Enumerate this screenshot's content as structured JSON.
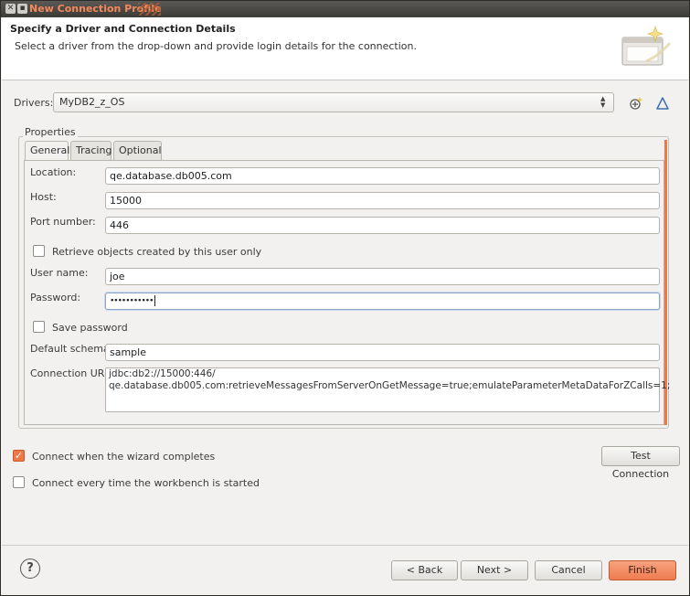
{
  "window": {
    "title": "New Connection Profile",
    "header_title": "Specify a Driver and Connection Details",
    "header_description": "Select a driver from the drop-down and provide login details for the connection."
  },
  "drivers": {
    "label": "Drivers:",
    "selected": "MyDB2_z_OS"
  },
  "properties": {
    "group_label": "Properties",
    "tabs": [
      {
        "label": "General",
        "active": true
      },
      {
        "label": "Tracing",
        "active": false
      },
      {
        "label": "Optional",
        "active": false
      }
    ],
    "location": {
      "label": "Location:",
      "value": "qe.database.db005.com"
    },
    "host": {
      "label": "Host:",
      "value": "15000"
    },
    "port": {
      "label": "Port number:",
      "value": "446"
    },
    "retrieve_own": {
      "label": "Retrieve objects created by this user only",
      "checked": false
    },
    "username": {
      "label": "User name:",
      "value": "joe"
    },
    "password": {
      "label": "Password:",
      "value": "•••••••••••"
    },
    "save_password": {
      "label": "Save password",
      "checked": false
    },
    "schema": {
      "label": "Default schema:",
      "value": "sample"
    },
    "url": {
      "label": "Connection URL:",
      "line1": "jdbc:db2://15000:446/",
      "line2": "qe.database.db005.com:retrieveMessagesFromServerOnGetMessage=true;emulateParameterMetaDataForZCalls=1;"
    }
  },
  "options": {
    "connect_on_finish": {
      "label": "Connect when the wizard completes",
      "checked": true
    },
    "connect_every_time": {
      "label": "Connect every time the workbench is started",
      "checked": false
    },
    "test_connection": "Test Connection"
  },
  "footer": {
    "help": "?",
    "back": "< Back",
    "next": "Next >",
    "cancel": "Cancel",
    "finish": "Finish"
  },
  "colors": {
    "accent": "#f07746",
    "title_text": "#f48a5c"
  },
  "icons": [
    "close-icon",
    "minimize-icon",
    "wizard-banner-icon",
    "new-driver-icon",
    "edit-driver-icon",
    "help-icon"
  ]
}
